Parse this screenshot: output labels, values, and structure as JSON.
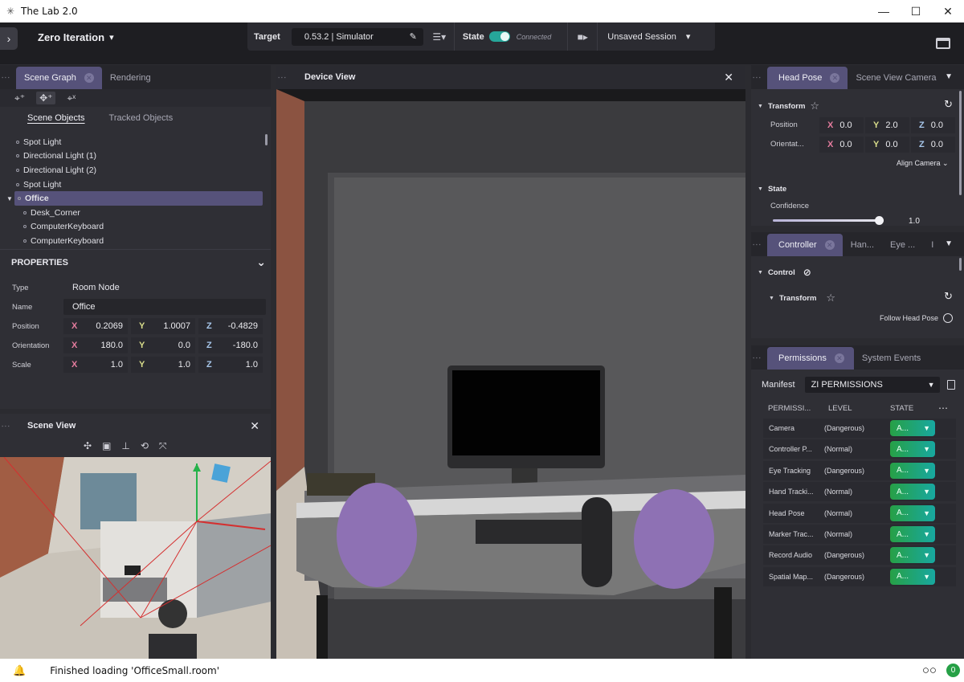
{
  "window": {
    "title": "The Lab 2.0",
    "minimize": "—",
    "maximize": "☐",
    "close": "✕"
  },
  "toolbar": {
    "project": "Zero Iteration",
    "target_label": "Target",
    "target_value": "0.53.2 | Simulator",
    "state_label": "State",
    "state_value": "Connected",
    "session": "Unsaved Session"
  },
  "scene_graph": {
    "tabs": [
      {
        "label": "Scene Graph",
        "active": true
      },
      {
        "label": "Rendering",
        "active": false
      }
    ],
    "subtabs": [
      "Scene Objects",
      "Tracked Objects"
    ],
    "tree": [
      {
        "label": "Spot Light",
        "depth": 0,
        "selected": false,
        "expanded": false
      },
      {
        "label": "Directional Light (1)",
        "depth": 0,
        "selected": false,
        "expanded": false
      },
      {
        "label": "Directional Light (2)",
        "depth": 0,
        "selected": false,
        "expanded": false
      },
      {
        "label": "Spot Light",
        "depth": 0,
        "selected": false,
        "expanded": false
      },
      {
        "label": "Office",
        "depth": 0,
        "selected": true,
        "expanded": true
      },
      {
        "label": "Desk_Corner",
        "depth": 1,
        "selected": false,
        "expanded": false
      },
      {
        "label": "ComputerKeyboard",
        "depth": 1,
        "selected": false,
        "expanded": false
      },
      {
        "label": "ComputerKeyboard",
        "depth": 1,
        "selected": false,
        "expanded": false
      }
    ]
  },
  "properties": {
    "title": "PROPERTIES",
    "type_label": "Type",
    "type_value": "Room Node",
    "name_label": "Name",
    "name_value": "Office",
    "position": {
      "label": "Position",
      "x": "0.2069",
      "y": "1.0007",
      "z": "-0.4829"
    },
    "orientation": {
      "label": "Orientation",
      "x": "180.0",
      "y": "0.0",
      "z": "-180.0"
    },
    "scale": {
      "label": "Scale",
      "x": "1.0",
      "y": "1.0",
      "z": "1.0"
    }
  },
  "axes": {
    "x": "X",
    "y": "Y",
    "z": "Z"
  },
  "scene_view": {
    "title": "Scene View"
  },
  "device_view": {
    "title": "Device View"
  },
  "head_pose": {
    "tabs": [
      {
        "label": "Head Pose",
        "active": true
      },
      {
        "label": "Scene View Camera",
        "active": false
      }
    ],
    "transform_label": "Transform",
    "position": {
      "label": "Position",
      "x": "0.0",
      "y": "2.0",
      "z": "0.0"
    },
    "orientation": {
      "label": "Orientat...",
      "x": "0.0",
      "y": "0.0",
      "z": "0.0"
    },
    "align_camera": "Align Camera",
    "state_label": "State",
    "confidence_label": "Confidence",
    "confidence_value": "1.0",
    "confidence_fraction": 0.96
  },
  "controller": {
    "tabs": [
      {
        "label": "Controller",
        "active": true
      },
      {
        "label": "Han...",
        "active": false
      },
      {
        "label": "Eye ...",
        "active": false
      },
      {
        "label": "I",
        "active": false
      }
    ],
    "control_label": "Control",
    "transform_label": "Transform",
    "follow_head_pose": "Follow Head Pose"
  },
  "permissions": {
    "tabs": [
      {
        "label": "Permissions",
        "active": true
      },
      {
        "label": "System Events",
        "active": false
      }
    ],
    "manifest_label": "Manifest",
    "manifest_value": "ZI PERMISSIONS",
    "columns": [
      "PERMISSI...",
      "LEVEL",
      "STATE"
    ],
    "rows": [
      {
        "name": "Camera",
        "level": "(Dangerous)",
        "state": "A..."
      },
      {
        "name": "Controller P...",
        "level": "(Normal)",
        "state": "A..."
      },
      {
        "name": "Eye Tracking",
        "level": "(Dangerous)",
        "state": "A..."
      },
      {
        "name": "Hand Tracki...",
        "level": "(Normal)",
        "state": "A..."
      },
      {
        "name": "Head Pose",
        "level": "(Normal)",
        "state": "A..."
      },
      {
        "name": "Marker Trac...",
        "level": "(Normal)",
        "state": "A..."
      },
      {
        "name": "Record Audio",
        "level": "(Dangerous)",
        "state": "A..."
      },
      {
        "name": "Spatial Map...",
        "level": "(Dangerous)",
        "state": "A..."
      }
    ]
  },
  "status": {
    "message": "Finished loading 'OfficeSmall.room'",
    "notifications": "0"
  },
  "colors": {
    "accent": "#56527a",
    "connected": "#26a69a",
    "state_allow": "#27a046",
    "panel_bg": "#2f2f35"
  }
}
